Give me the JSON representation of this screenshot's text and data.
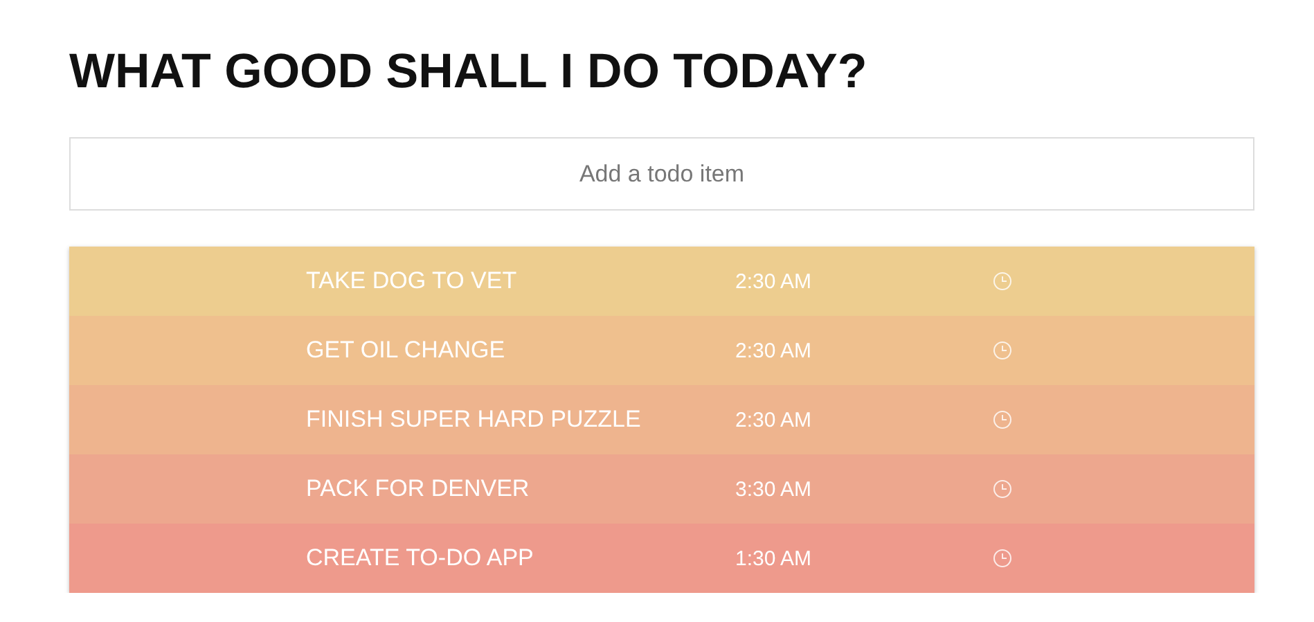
{
  "title": "WHAT GOOD SHALL I DO TODAY?",
  "input": {
    "placeholder": "Add a todo item"
  },
  "todos": [
    {
      "text": "TAKE DOG TO VET",
      "time": "2:30 AM",
      "color": "#edcd8f"
    },
    {
      "text": "GET OIL CHANGE",
      "time": "2:30 AM",
      "color": "#efc08e"
    },
    {
      "text": "FINISH SUPER HARD PUZZLE",
      "time": "2:30 AM",
      "color": "#eeb48e"
    },
    {
      "text": "PACK FOR DENVER",
      "time": "3:30 AM",
      "color": "#eda78e"
    },
    {
      "text": "CREATE TO-DO APP",
      "time": "1:30 AM",
      "color": "#ee9a8c"
    }
  ]
}
